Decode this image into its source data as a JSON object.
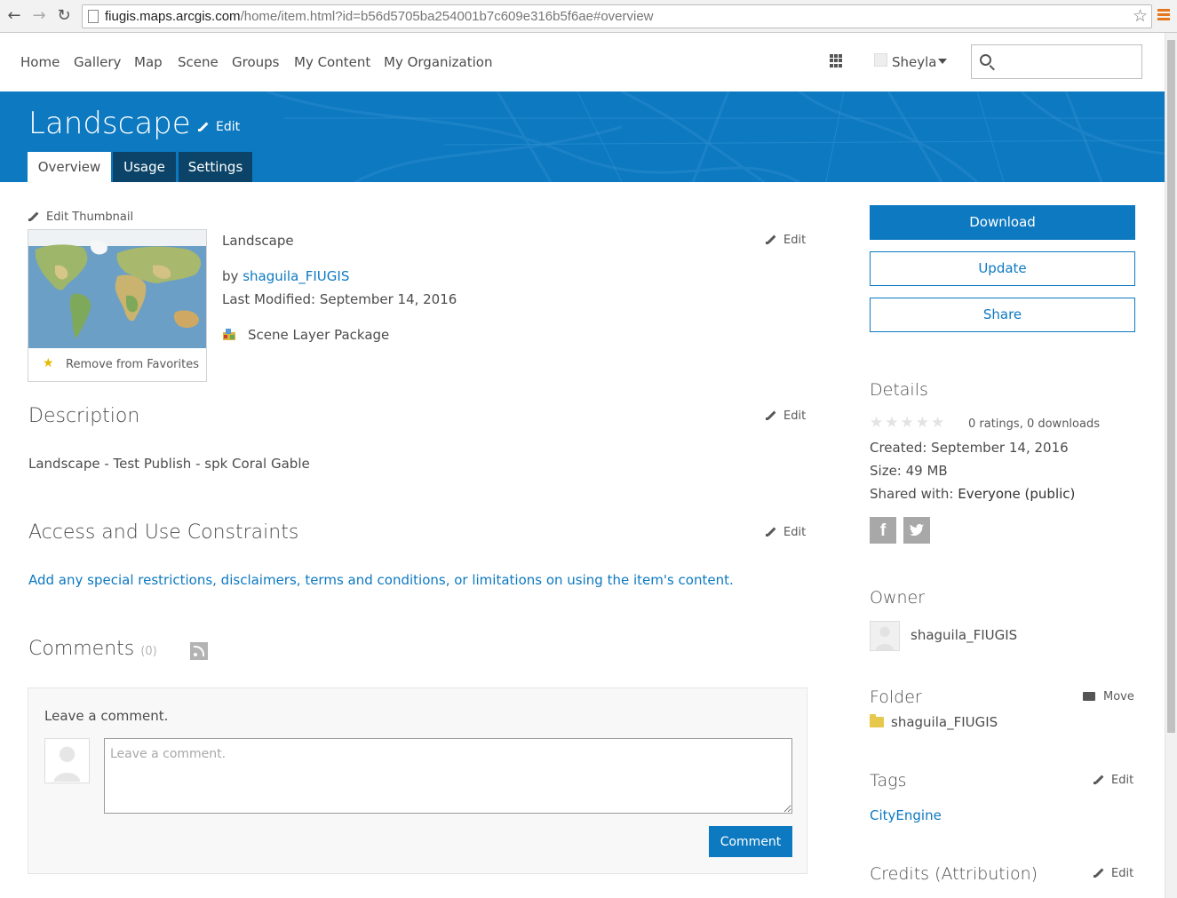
{
  "browser": {
    "url_host": "fiugis.maps.arcgis.com",
    "url_path": "/home/item.html?id=b56d5705ba254001b7c609e316b5f6ae#overview"
  },
  "nav": {
    "links": [
      "Home",
      "Gallery",
      "Map",
      "Scene",
      "Groups",
      "My Content",
      "My Organization"
    ],
    "user": "Sheyla",
    "search_placeholder": ""
  },
  "banner": {
    "title": "Landscape",
    "edit_label": "Edit",
    "tabs": [
      "Overview",
      "Usage",
      "Settings"
    ],
    "active_tab": "Overview",
    "color": "#0d79c1"
  },
  "thumbnail": {
    "edit_label": "Edit Thumbnail",
    "favorite_label": "Remove from Favorites"
  },
  "item": {
    "title": "Landscape",
    "by_prefix": "by",
    "owner": "shaguila_FIUGIS",
    "modified_label": "Last Modified: September 14, 2016",
    "type": "Scene Layer Package",
    "edit_label": "Edit"
  },
  "description": {
    "heading": "Description",
    "text": "Landscape - Test Publish - spk Coral Gable",
    "edit_label": "Edit"
  },
  "constraints": {
    "heading": "Access and Use Constraints",
    "placeholder_link": "Add any special restrictions, disclaimers, terms and conditions, or limitations on using the item's content.",
    "edit_label": "Edit"
  },
  "comments": {
    "heading": "Comments",
    "count": "(0)",
    "box_title": "Leave a comment.",
    "input_placeholder": "Leave a comment.",
    "submit_label": "Comment"
  },
  "actions": {
    "download": "Download",
    "update": "Update",
    "share": "Share"
  },
  "details": {
    "heading": "Details",
    "ratings": "0 ratings, 0 downloads",
    "rating_value": 0,
    "created": "Created: September 14, 2016",
    "size": "Size: 49 MB",
    "shared_label": "Shared with:",
    "shared_value": "Everyone (public)"
  },
  "owner": {
    "heading": "Owner",
    "name": "shaguila_FIUGIS"
  },
  "folder": {
    "heading": "Folder",
    "name": "shaguila_FIUGIS",
    "move_label": "Move"
  },
  "tags": {
    "heading": "Tags",
    "items": [
      "CityEngine"
    ],
    "edit_label": "Edit"
  },
  "credits": {
    "heading": "Credits (Attribution)",
    "edit_label": "Edit"
  }
}
